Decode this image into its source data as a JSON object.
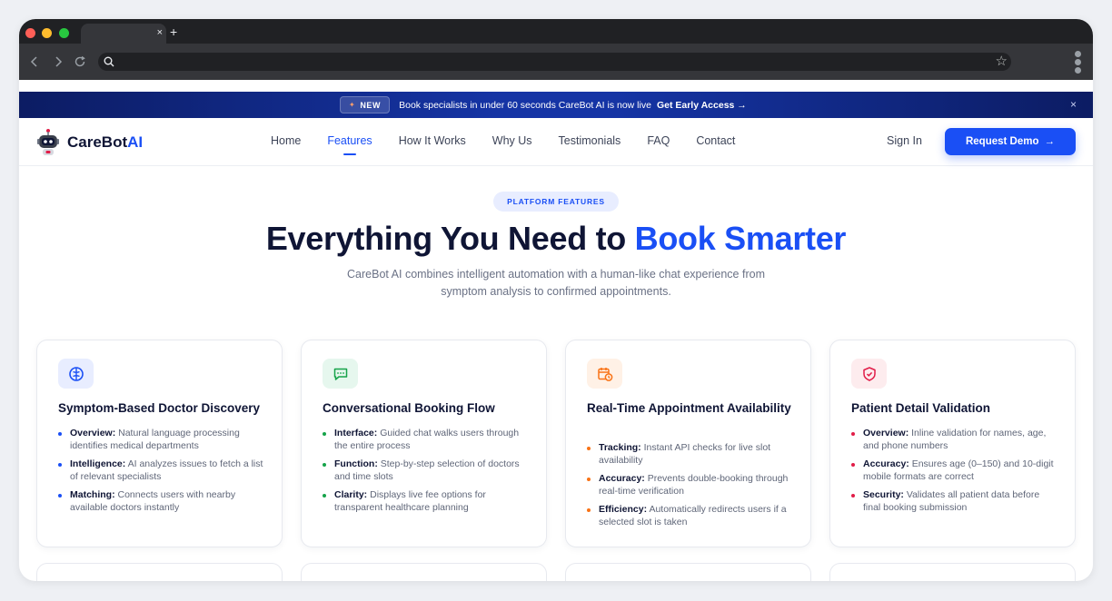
{
  "browser": {
    "tab_close": "×",
    "new_tab": "+",
    "star": "☆"
  },
  "banner": {
    "badge": "NEW",
    "text": "Book specialists in under 60 seconds CareBot AI is now live",
    "cta": "Get Early Access →",
    "close": "×"
  },
  "header": {
    "logo_text": "CareBot",
    "logo_accent": "AI",
    "nav": [
      "Home",
      "Features",
      "How It Works",
      "Why Us",
      "Testimonials",
      "FAQ",
      "Contact"
    ],
    "active_nav": "Features",
    "sign_in": "Sign In",
    "demo_label": "Request Demo",
    "demo_arrow": "→"
  },
  "hero": {
    "pill": "PLATFORM FEATURES",
    "title_main": "Everything You Need to",
    "title_accent": "Book Smarter",
    "subtitle": "CareBot AI combines intelligent automation with a human-like chat experience from symptom analysis to confirmed appointments."
  },
  "cards": [
    {
      "icon": "brain-icon",
      "icon_bg": "#e8edff",
      "accent": "#1a4ff5",
      "title": "Symptom-Based Doctor Discovery",
      "items": [
        {
          "key": "Overview:",
          "text": "Natural language processing identifies medical departments"
        },
        {
          "key": "Intelligence:",
          "text": "AI analyzes issues to fetch a list of relevant specialists"
        },
        {
          "key": "Matching:",
          "text": "Connects users with nearby available doctors instantly"
        }
      ]
    },
    {
      "icon": "chat-icon",
      "icon_bg": "#e6f7ee",
      "accent": "#16a34a",
      "title": "Conversational Booking Flow",
      "items": [
        {
          "key": "Interface:",
          "text": "Guided chat walks users through the entire process"
        },
        {
          "key": "Function:",
          "text": "Step-by-step selection of doctors and time slots"
        },
        {
          "key": "Clarity:",
          "text": "Displays live fee options for transparent healthcare planning"
        }
      ]
    },
    {
      "icon": "calendar-clock-icon",
      "icon_bg": "#fff1e6",
      "accent": "#f97316",
      "title": "Real-Time Appointment Availability",
      "items": [
        {
          "key": "Tracking:",
          "text": "Instant API checks for live slot availability"
        },
        {
          "key": "Accuracy:",
          "text": "Prevents double-booking through real-time verification"
        },
        {
          "key": "Efficiency:",
          "text": "Automatically redirects users if a selected slot is taken"
        }
      ]
    },
    {
      "icon": "shield-check-icon",
      "icon_bg": "#fdecee",
      "accent": "#e11d48",
      "title": "Patient Detail Validation",
      "items": [
        {
          "key": "Overview:",
          "text": "Inline validation for names, age, and phone numbers"
        },
        {
          "key": "Accuracy:",
          "text": "Ensures age (0–150) and 10-digit mobile formats are correct"
        },
        {
          "key": "Security:",
          "text": "Validates all patient data before final booking submission"
        }
      ]
    }
  ]
}
